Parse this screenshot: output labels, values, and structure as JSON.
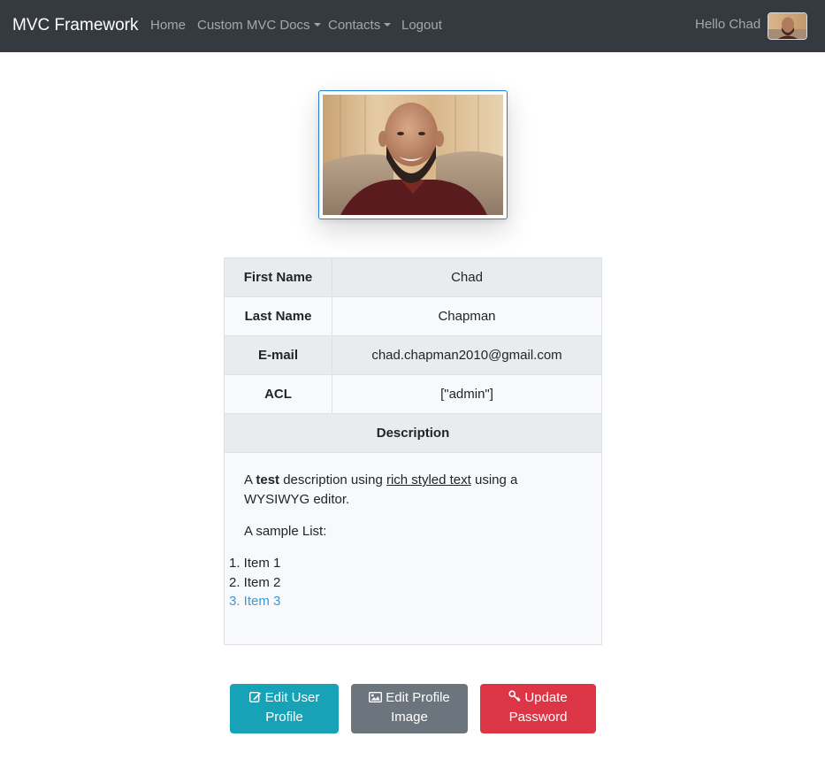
{
  "navbar": {
    "brand": "MVC Framework",
    "links": [
      {
        "label": "Home"
      },
      {
        "label": "Custom MVC Docs",
        "dropdown": true
      },
      {
        "label": "Contacts",
        "dropdown": true
      },
      {
        "label": "Logout"
      }
    ],
    "greeting": "Hello Chad"
  },
  "profile": {
    "rows": [
      {
        "label": "First Name",
        "value": "Chad"
      },
      {
        "label": "Last Name",
        "value": "Chapman"
      },
      {
        "label": "E-mail",
        "value": "chad.chapman2010@gmail.com"
      },
      {
        "label": "ACL",
        "value": "[\"admin\"]"
      }
    ],
    "description_header": "Description",
    "description": {
      "p1_before": "A ",
      "p1_bold": "test",
      "p1_mid": " description using ",
      "p1_underline": "rich styled text",
      "p1_after": " using a WYSIWYG editor.",
      "p2": "A sample List:",
      "list": [
        "1. Item 1",
        "2. Item 2",
        "3. Item 3"
      ]
    }
  },
  "buttons": {
    "edit_profile": "Edit User Profile",
    "edit_image": "Edit Profile Image",
    "update_password": "Update Password"
  },
  "colors": {
    "navbar": "#343a40",
    "info": "#17a2b8",
    "secondary": "#6c757d",
    "danger": "#dc3545",
    "list_highlight": "#3a9bd5"
  },
  "icons": {
    "edit_profile": "edit-icon",
    "edit_image": "image-icon",
    "update_password": "key-icon"
  }
}
